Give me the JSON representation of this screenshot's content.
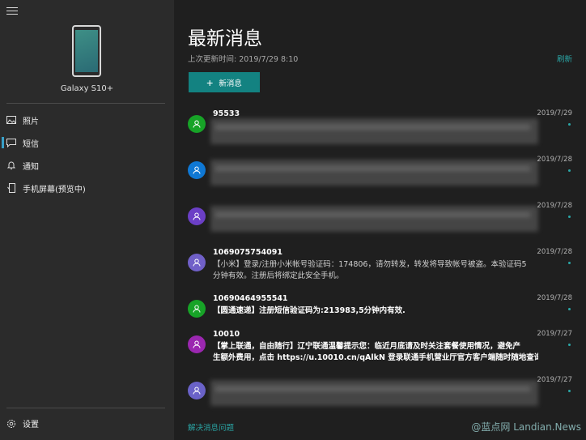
{
  "sidebar": {
    "device_name": "Galaxy S10+",
    "nav": [
      {
        "label": "照片",
        "icon": "photo-icon"
      },
      {
        "label": "短信",
        "icon": "message-icon",
        "active": true
      },
      {
        "label": "通知",
        "icon": "bell-icon"
      },
      {
        "label": "手机屏幕(预览中)",
        "icon": "phone-screen-icon"
      }
    ],
    "settings_label": "设置"
  },
  "main": {
    "title": "最新消息",
    "last_update": "上次更新时间: 2019/7/29 8:10",
    "refresh_label": "刷新",
    "new_message_label": "新消息",
    "troubleshoot_label": "解决消息问题"
  },
  "conversations": [
    {
      "sender": "95533",
      "date": "2019/7/29",
      "color": "#17a327",
      "blurred": true
    },
    {
      "sender": "",
      "date": "2019/7/28",
      "color": "#0f78d4",
      "blurred": true
    },
    {
      "sender": "",
      "date": "2019/7/28",
      "color": "#6b3fc6",
      "blurred": true
    },
    {
      "sender": "1069075754091",
      "date": "2019/7/28",
      "color": "#7060c8",
      "blurred": false,
      "bold": false,
      "lines": [
        "【小米】登录/注册小米帐号验证码：174806，请勿转发，转发将导致帐号被盗。本验证码5",
        "分钟有效。注册后将绑定此安全手机。"
      ]
    },
    {
      "sender": "10690464955541",
      "date": "2019/7/28",
      "color": "#17a327",
      "blurred": false,
      "bold": true,
      "lines": [
        "【圆通速递】注册短信验证码为:213983,5分钟内有效."
      ]
    },
    {
      "sender": "10010",
      "date": "2019/7/27",
      "color": "#9b27b0",
      "blurred": false,
      "bold": true,
      "lines": [
        "【掌上联通，自由随行】辽宁联通温馨提示您：临近月底请及时关注套餐使用情况，避免产",
        "生额外费用，点击 https://u.10010.cn/qAlkN 登录联通手机营业厅官方客户端随时随地查询套"
      ]
    },
    {
      "sender": "",
      "date": "2019/7/27",
      "color": "#6a62c8",
      "blurred": true
    }
  ],
  "watermark": "@蓝点网 Landian.News",
  "colors": {
    "accent": "#138281",
    "link": "#2aa6a6",
    "sidebar_bg": "#2b2b2b",
    "main_bg": "#1f1f1f"
  }
}
